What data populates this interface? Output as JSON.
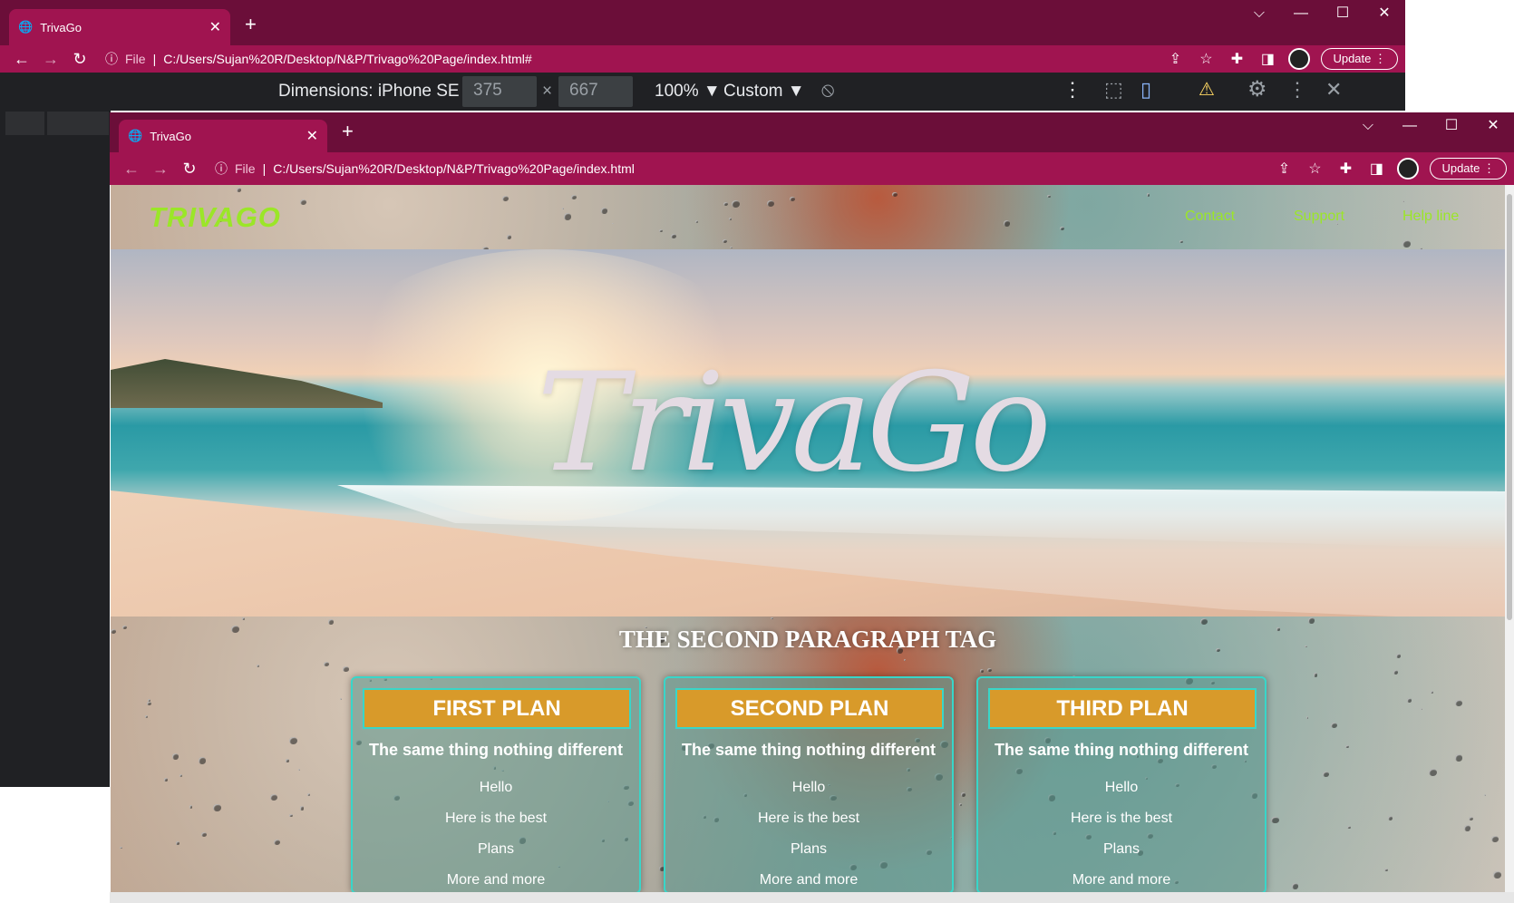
{
  "outer": {
    "tab_title": "TrivaGo",
    "url_prefix": "File",
    "url": "C:/Users/Sujan%20R/Desktop/N&P/Trivago%20Page/index.html#",
    "update_label": "Update",
    "devtools": {
      "dimensions_label": "Dimensions: iPhone SE ▼",
      "width": "375",
      "times": "×",
      "height": "667",
      "zoom": "100% ▼",
      "throttle": "Custom ▼"
    }
  },
  "inner": {
    "tab_title": "TrivaGo",
    "url_prefix": "File",
    "url": "C:/Users/Sujan%20R/Desktop/N&P/Trivago%20Page/index.html",
    "update_label": "Update"
  },
  "site": {
    "logo": "TRIVAGO",
    "nav": [
      "Contact",
      "Support",
      "Help line"
    ],
    "hero_script": "TrivaGo",
    "section_title": "THE SECOND PARAGRAPH TAG",
    "plans": [
      {
        "title": "FIRST PLAN",
        "subtitle": "The same thing nothing different",
        "items": [
          "Hello",
          "Here is the best",
          "Plans",
          "More and more"
        ]
      },
      {
        "title": "SECOND PLAN",
        "subtitle": "The same thing nothing different",
        "items": [
          "Hello",
          "Here is the best",
          "Plans",
          "More and more"
        ]
      },
      {
        "title": "THIRD PLAN",
        "subtitle": "The same thing nothing different",
        "items": [
          "Hello",
          "Here is the best",
          "Plans",
          "More and more"
        ]
      }
    ]
  },
  "colors": {
    "chrome": "#6b0e39",
    "chrome_active": "#a01450",
    "logo": "#9be628",
    "card_title": "#d89a2a",
    "card_border": "#38d6c9"
  }
}
